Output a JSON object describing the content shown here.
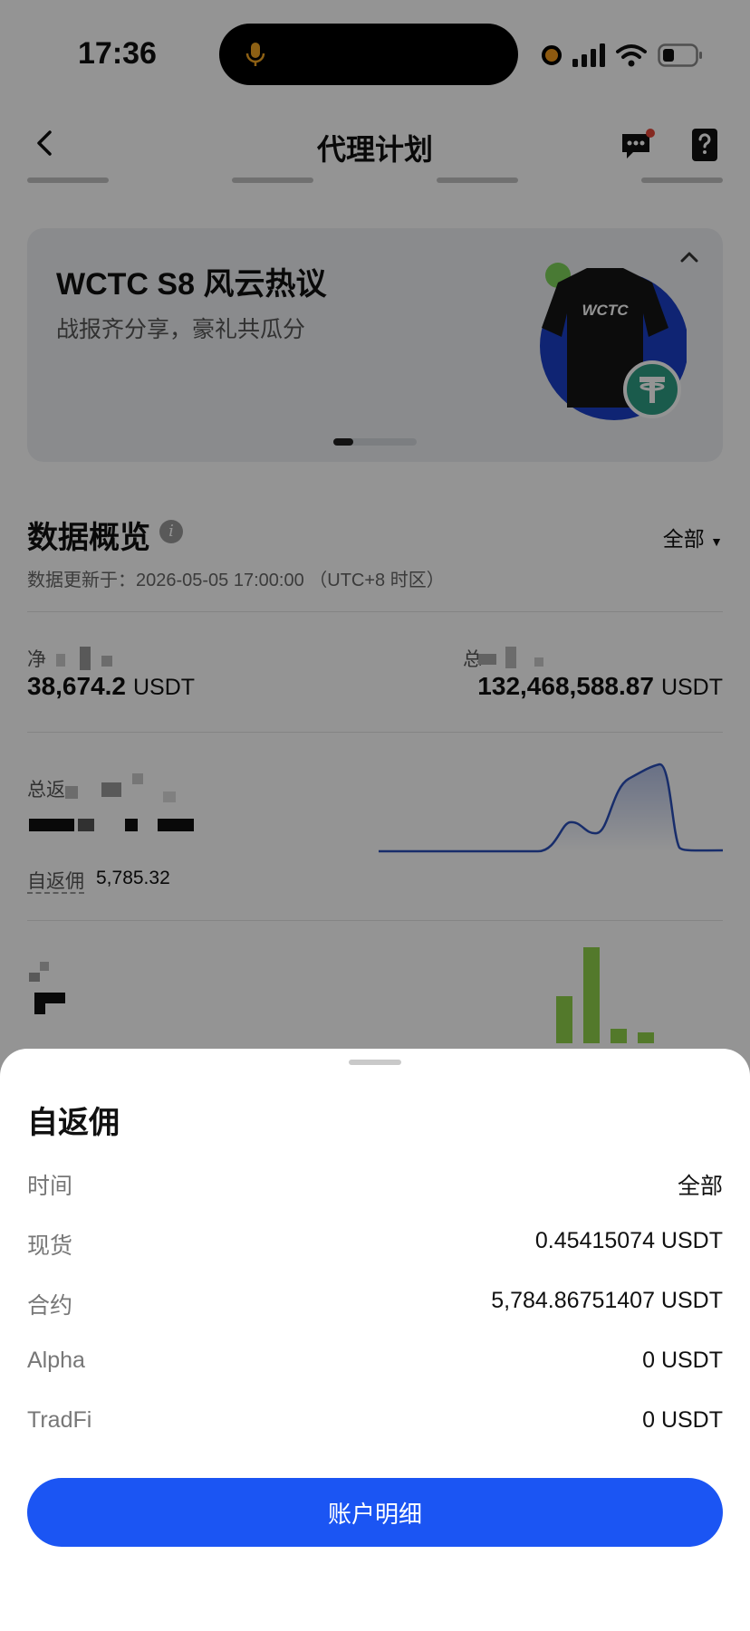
{
  "status_bar": {
    "time": "17:36"
  },
  "nav": {
    "title": "代理计划"
  },
  "banner": {
    "title": "WCTC S8 风云热议",
    "subtitle": "战报齐分享，豪礼共瓜分",
    "shirt_text": "WCTC"
  },
  "overview": {
    "title": "数据概览",
    "filter": "全部",
    "updated": "数据更新于：2026-05-05 17:00:00 （UTC+8 时区）",
    "metric1": {
      "label": "净",
      "value": "38,674.2",
      "unit": "USDT"
    },
    "metric2": {
      "label": "总",
      "value": "132,468,588.87",
      "unit": "USDT"
    },
    "metric3": {
      "label": "总返"
    },
    "self_rebate": {
      "label": "自返佣",
      "value": "5,785.32"
    }
  },
  "sheet": {
    "title": "自返佣",
    "rows": [
      {
        "label": "时间",
        "value": "全部"
      },
      {
        "label": "现货",
        "value": "0.45415074 USDT"
      },
      {
        "label": "合约",
        "value": "5,784.86751407 USDT"
      },
      {
        "label": "Alpha",
        "value": "0 USDT"
      },
      {
        "label": "TradFi",
        "value": "0 USDT"
      }
    ],
    "button": "账户明细"
  },
  "colors": {
    "primary": "#1b55f3",
    "line": "#2a4fb8",
    "bar": "#8fd14a",
    "banner_bg": "#eef0f3"
  }
}
